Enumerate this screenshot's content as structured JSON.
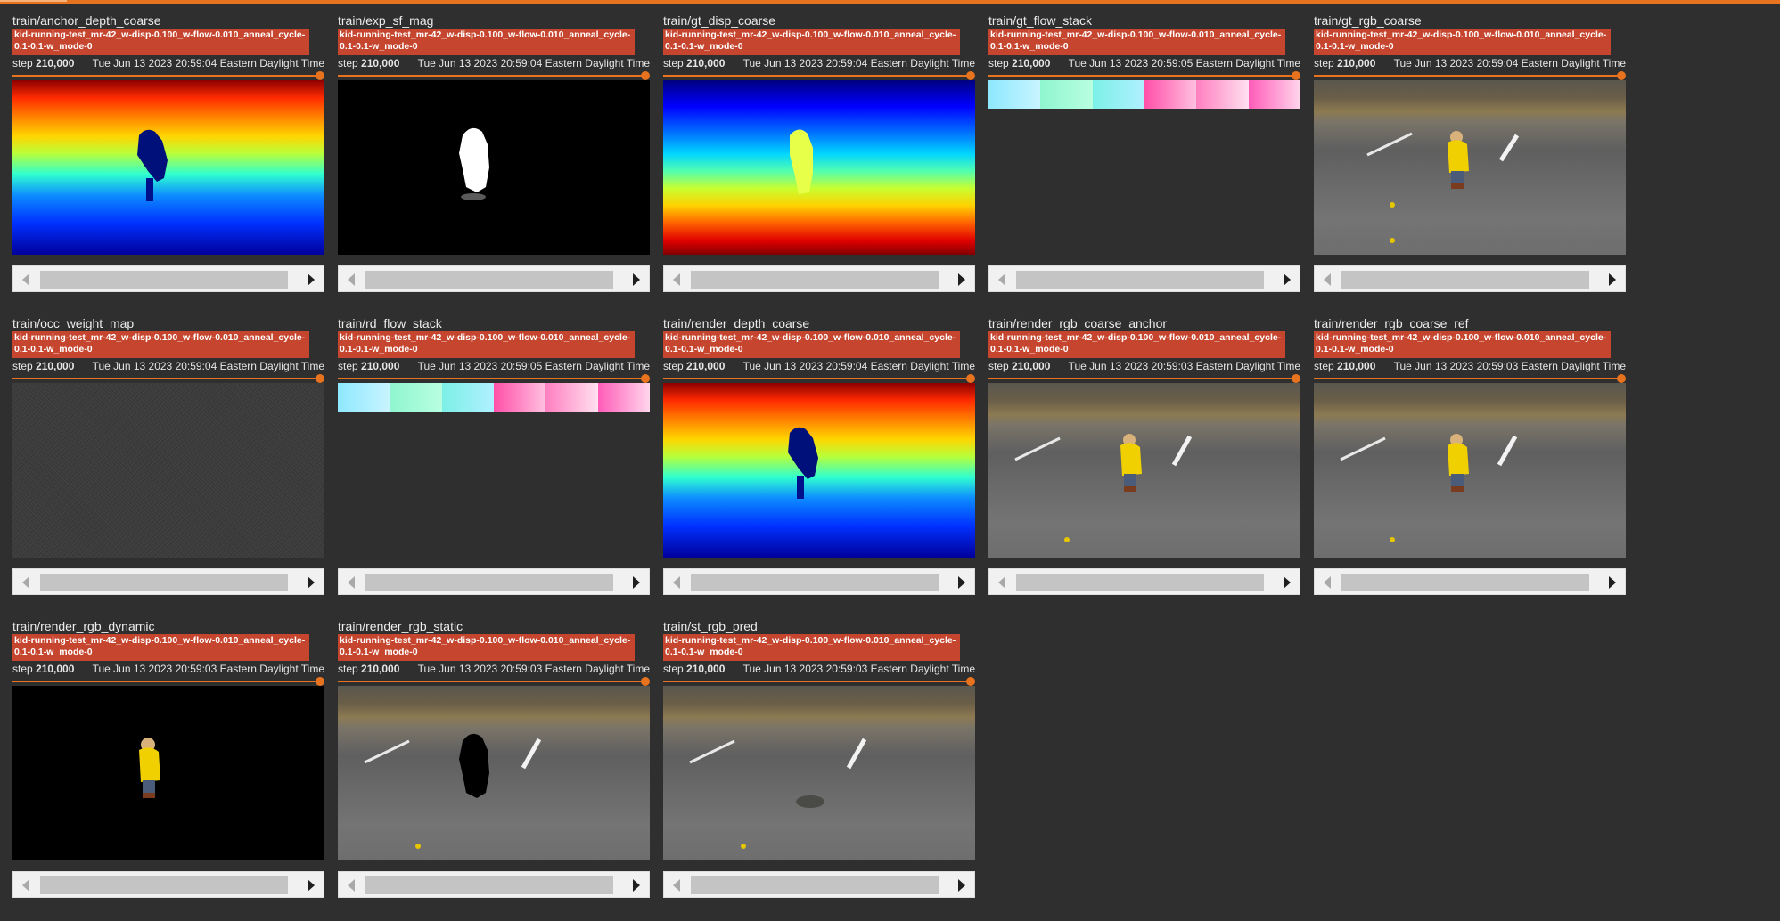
{
  "run_name": "kid-running-test_mr-42_w-disp-0.100_w-flow-0.010_anneal_cycle-0.1-0.1-w_mode-0",
  "step_label": "step",
  "step_value": "210,000",
  "accent_color": "#e8731f",
  "tag_color": "#c6452e",
  "cards": [
    {
      "title": "train/anchor_depth_coarse",
      "time": "Tue Jun 13 2023 20:59:04 Eastern Daylight Time",
      "image": "depth-colormap"
    },
    {
      "title": "train/exp_sf_mag",
      "time": "Tue Jun 13 2023 20:59:04 Eastern Daylight Time",
      "image": "flow-magnitude"
    },
    {
      "title": "train/gt_disp_coarse",
      "time": "Tue Jun 13 2023 20:59:04 Eastern Daylight Time",
      "image": "disparity-colormap"
    },
    {
      "title": "train/gt_flow_stack",
      "time": "Tue Jun 13 2023 20:59:05 Eastern Daylight Time",
      "image": "flow-stack"
    },
    {
      "title": "train/gt_rgb_coarse",
      "time": "Tue Jun 13 2023 20:59:04 Eastern Daylight Time",
      "image": "rgb-photo"
    },
    {
      "title": "train/occ_weight_map",
      "time": "Tue Jun 13 2023 20:59:04 Eastern Daylight Time",
      "image": "noise-map"
    },
    {
      "title": "train/rd_flow_stack",
      "time": "Tue Jun 13 2023 20:59:05 Eastern Daylight Time",
      "image": "flow-stack"
    },
    {
      "title": "train/render_depth_coarse",
      "time": "Tue Jun 13 2023 20:59:04 Eastern Daylight Time",
      "image": "depth-colormap"
    },
    {
      "title": "train/render_rgb_coarse_anchor",
      "time": "Tue Jun 13 2023 20:59:03 Eastern Daylight Time",
      "image": "rgb-photo"
    },
    {
      "title": "train/render_rgb_coarse_ref",
      "time": "Tue Jun 13 2023 20:59:03 Eastern Daylight Time",
      "image": "rgb-photo"
    },
    {
      "title": "train/render_rgb_dynamic",
      "time": "Tue Jun 13 2023 20:59:03 Eastern Daylight Time",
      "image": "dynamic-rgb"
    },
    {
      "title": "train/render_rgb_static",
      "time": "Tue Jun 13 2023 20:59:03 Eastern Daylight Time",
      "image": "static-rgb"
    },
    {
      "title": "train/st_rgb_pred",
      "time": "Tue Jun 13 2023 20:59:03 Eastern Daylight Time",
      "image": "static-rgb-pred"
    }
  ]
}
